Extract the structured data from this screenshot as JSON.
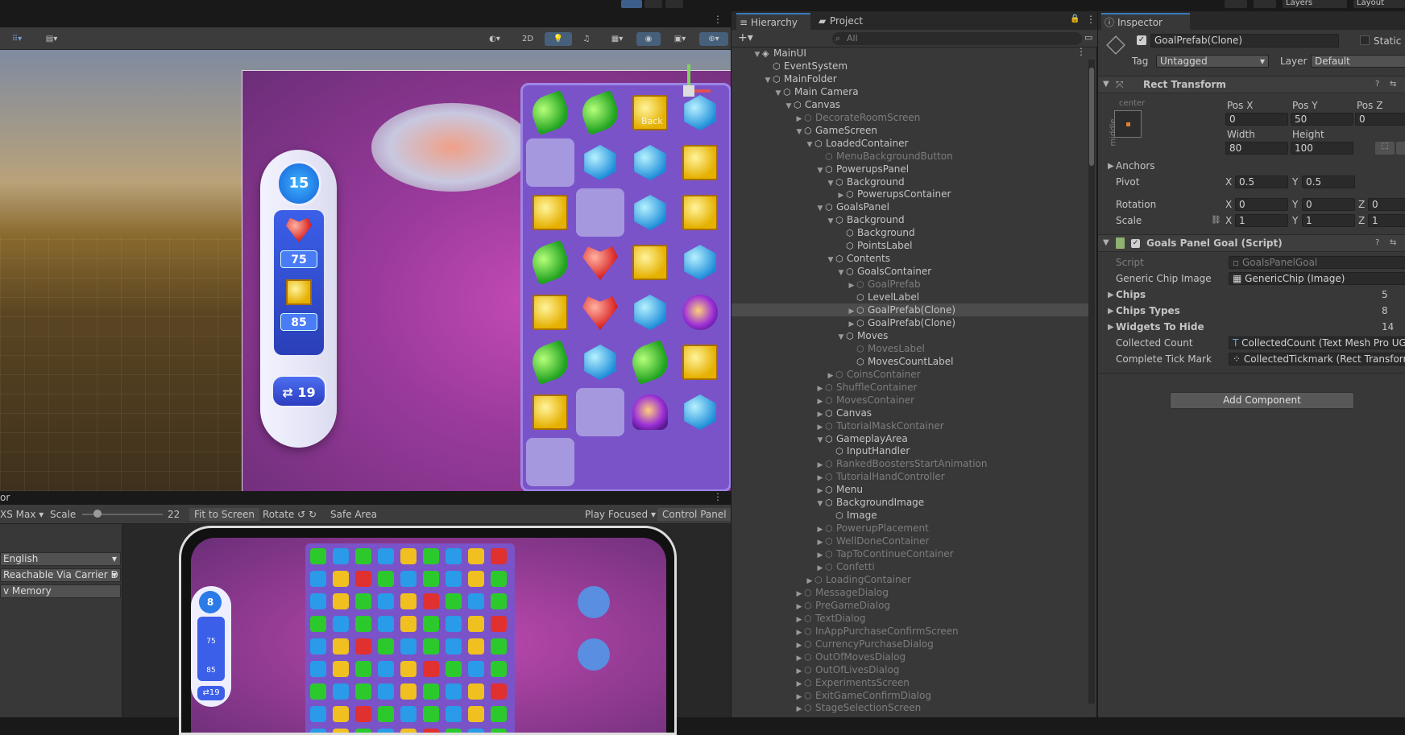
{
  "topbar": {
    "layers": "Layers",
    "layout": "Layout"
  },
  "scene": {
    "toolbar": {
      "mode_2d": "2D"
    },
    "game_art": {
      "moves_value": "15",
      "goal_count_1": "75",
      "goal_count_2": "85",
      "coins_value": "19",
      "back_label": "Back"
    }
  },
  "game_view": {
    "tab_label": "or",
    "device": "XS Max",
    "scale_label": "Scale",
    "scale_value": "22",
    "scale_level": 0.15,
    "fit_to_screen": "Fit to Screen",
    "rotate": "Rotate",
    "safe_area": "Safe Area",
    "play_focused": "Play Focused",
    "control_panel": "Control Panel",
    "language": "English",
    "network": "Reachable Via Carrier D",
    "memory": "v Memory",
    "mini_moves": "8",
    "mini_goal_1": "75",
    "mini_goal_2": "85",
    "mini_coins": "19"
  },
  "hierarchy": {
    "tab_hierarchy": "Hierarchy",
    "tab_project": "Project",
    "search_placeholder": "All",
    "rows": [
      {
        "label": "MainUI",
        "indent": 0,
        "arrow": "▼",
        "dim": false,
        "sel": false,
        "icon": "unity"
      },
      {
        "label": "EventSystem",
        "indent": 1,
        "arrow": "",
        "dim": false,
        "sel": false
      },
      {
        "label": "MainFolder",
        "indent": 1,
        "arrow": "▼",
        "dim": false,
        "sel": false
      },
      {
        "label": "Main Camera",
        "indent": 2,
        "arrow": "▼",
        "dim": false,
        "sel": false
      },
      {
        "label": "Canvas",
        "indent": 3,
        "arrow": "▼",
        "dim": false,
        "sel": false
      },
      {
        "label": "DecorateRoomScreen",
        "indent": 4,
        "arrow": "▶",
        "dim": true,
        "sel": false
      },
      {
        "label": "GameScreen",
        "indent": 4,
        "arrow": "▼",
        "dim": false,
        "sel": false
      },
      {
        "label": "LoadedContainer",
        "indent": 5,
        "arrow": "▼",
        "dim": false,
        "sel": false
      },
      {
        "label": "MenuBackgroundButton",
        "indent": 6,
        "arrow": "",
        "dim": true,
        "sel": false
      },
      {
        "label": "PowerupsPanel",
        "indent": 6,
        "arrow": "▼",
        "dim": false,
        "sel": false
      },
      {
        "label": "Background",
        "indent": 7,
        "arrow": "▼",
        "dim": false,
        "sel": false
      },
      {
        "label": "PowerupsContainer",
        "indent": 8,
        "arrow": "▶",
        "dim": false,
        "sel": false
      },
      {
        "label": "GoalsPanel",
        "indent": 6,
        "arrow": "▼",
        "dim": false,
        "sel": false
      },
      {
        "label": "Background",
        "indent": 7,
        "arrow": "▼",
        "dim": false,
        "sel": false
      },
      {
        "label": "Background",
        "indent": 8,
        "arrow": "",
        "dim": false,
        "sel": false
      },
      {
        "label": "PointsLabel",
        "indent": 8,
        "arrow": "",
        "dim": false,
        "sel": false
      },
      {
        "label": "Contents",
        "indent": 7,
        "arrow": "▼",
        "dim": false,
        "sel": false
      },
      {
        "label": "GoalsContainer",
        "indent": 8,
        "arrow": "▼",
        "dim": false,
        "sel": false
      },
      {
        "label": "GoalPrefab",
        "indent": 9,
        "arrow": "▶",
        "dim": true,
        "sel": false
      },
      {
        "label": "LevelLabel",
        "indent": 9,
        "arrow": "",
        "dim": false,
        "sel": false
      },
      {
        "label": "GoalPrefab(Clone)",
        "indent": 9,
        "arrow": "▶",
        "dim": false,
        "sel": true
      },
      {
        "label": "GoalPrefab(Clone)",
        "indent": 9,
        "arrow": "▶",
        "dim": false,
        "sel": false
      },
      {
        "label": "Moves",
        "indent": 8,
        "arrow": "▼",
        "dim": false,
        "sel": false
      },
      {
        "label": "MovesLabel",
        "indent": 9,
        "arrow": "",
        "dim": true,
        "sel": false
      },
      {
        "label": "MovesCountLabel",
        "indent": 9,
        "arrow": "",
        "dim": false,
        "sel": false
      },
      {
        "label": "CoinsContainer",
        "indent": 7,
        "arrow": "▶",
        "dim": true,
        "sel": false
      },
      {
        "label": "ShuffleContainer",
        "indent": 6,
        "arrow": "▶",
        "dim": true,
        "sel": false
      },
      {
        "label": "MovesContainer",
        "indent": 6,
        "arrow": "▶",
        "dim": true,
        "sel": false
      },
      {
        "label": "Canvas",
        "indent": 6,
        "arrow": "▶",
        "dim": false,
        "sel": false
      },
      {
        "label": "TutorialMaskContainer",
        "indent": 6,
        "arrow": "▶",
        "dim": true,
        "sel": false
      },
      {
        "label": "GameplayArea",
        "indent": 6,
        "arrow": "▼",
        "dim": false,
        "sel": false
      },
      {
        "label": "InputHandler",
        "indent": 7,
        "arrow": "",
        "dim": false,
        "sel": false
      },
      {
        "label": "RankedBoostersStartAnimation",
        "indent": 6,
        "arrow": "▶",
        "dim": true,
        "sel": false
      },
      {
        "label": "TutorialHandController",
        "indent": 6,
        "arrow": "▶",
        "dim": true,
        "sel": false
      },
      {
        "label": "Menu",
        "indent": 6,
        "arrow": "▶",
        "dim": false,
        "sel": false
      },
      {
        "label": "BackgroundImage",
        "indent": 6,
        "arrow": "▼",
        "dim": false,
        "sel": false
      },
      {
        "label": "Image",
        "indent": 7,
        "arrow": "",
        "dim": false,
        "sel": false
      },
      {
        "label": "PowerupPlacement",
        "indent": 6,
        "arrow": "▶",
        "dim": true,
        "sel": false
      },
      {
        "label": "WellDoneContainer",
        "indent": 6,
        "arrow": "▶",
        "dim": true,
        "sel": false
      },
      {
        "label": "TapToContinueContainer",
        "indent": 6,
        "arrow": "▶",
        "dim": true,
        "sel": false
      },
      {
        "label": "Confetti",
        "indent": 6,
        "arrow": "▶",
        "dim": true,
        "sel": false
      },
      {
        "label": "LoadingContainer",
        "indent": 5,
        "arrow": "▶",
        "dim": true,
        "sel": false
      },
      {
        "label": "MessageDialog",
        "indent": 4,
        "arrow": "▶",
        "dim": true,
        "sel": false
      },
      {
        "label": "PreGameDialog",
        "indent": 4,
        "arrow": "▶",
        "dim": true,
        "sel": false
      },
      {
        "label": "TextDialog",
        "indent": 4,
        "arrow": "▶",
        "dim": true,
        "sel": false
      },
      {
        "label": "InAppPurchaseConfirmScreen",
        "indent": 4,
        "arrow": "▶",
        "dim": true,
        "sel": false
      },
      {
        "label": "CurrencyPurchaseDialog",
        "indent": 4,
        "arrow": "▶",
        "dim": true,
        "sel": false
      },
      {
        "label": "OutOfMovesDialog",
        "indent": 4,
        "arrow": "▶",
        "dim": true,
        "sel": false
      },
      {
        "label": "OutOfLivesDialog",
        "indent": 4,
        "arrow": "▶",
        "dim": true,
        "sel": false
      },
      {
        "label": "ExperimentsScreen",
        "indent": 4,
        "arrow": "▶",
        "dim": true,
        "sel": false
      },
      {
        "label": "ExitGameConfirmDialog",
        "indent": 4,
        "arrow": "▶",
        "dim": true,
        "sel": false
      },
      {
        "label": "StageSelectionScreen",
        "indent": 4,
        "arrow": "▶",
        "dim": true,
        "sel": false
      }
    ]
  },
  "inspector": {
    "tab_label": "Inspector",
    "object_name": "GoalPrefab(Clone)",
    "static_label": "Static",
    "tag_label": "Tag",
    "tag_value": "Untagged",
    "layer_label": "Layer",
    "layer_value": "Default",
    "rect_transform": {
      "title": "Rect Transform",
      "anchor_h": "center",
      "anchor_v": "middle",
      "pos_x_label": "Pos X",
      "pos_x": "0",
      "pos_y_label": "Pos Y",
      "pos_y": "50",
      "pos_z_label": "Pos Z",
      "pos_z": "0",
      "width_label": "Width",
      "width": "80",
      "height_label": "Height",
      "height": "100",
      "anchors_label": "Anchors",
      "pivot_label": "Pivot",
      "pivot_x": "0.5",
      "pivot_y": "0.5",
      "rotation_label": "Rotation",
      "rot_x": "0",
      "rot_y": "0",
      "rot_z": "0",
      "scale_label": "Scale",
      "scale_x": "1",
      "scale_y": "1",
      "scale_z": "1",
      "x": "X",
      "y": "Y",
      "z": "Z"
    },
    "goals_script": {
      "title": "Goals Panel Goal (Script)",
      "script_label": "Script",
      "script_value": "GoalsPanelGoal",
      "chip_image_label": "Generic Chip Image",
      "chip_image_value": "GenericChip (Image)",
      "chips_label": "Chips",
      "chips_value": "5",
      "chip_types_label": "Chips Types",
      "chip_types_value": "8",
      "widgets_label": "Widgets To Hide",
      "widgets_value": "14",
      "collected_label": "Collected Count",
      "collected_value": "CollectedCount (Text Mesh Pro UGUI)",
      "tick_label": "Complete Tick Mark",
      "tick_value": "CollectedTickmark (Rect Transform)"
    },
    "add_component": "Add Component"
  }
}
